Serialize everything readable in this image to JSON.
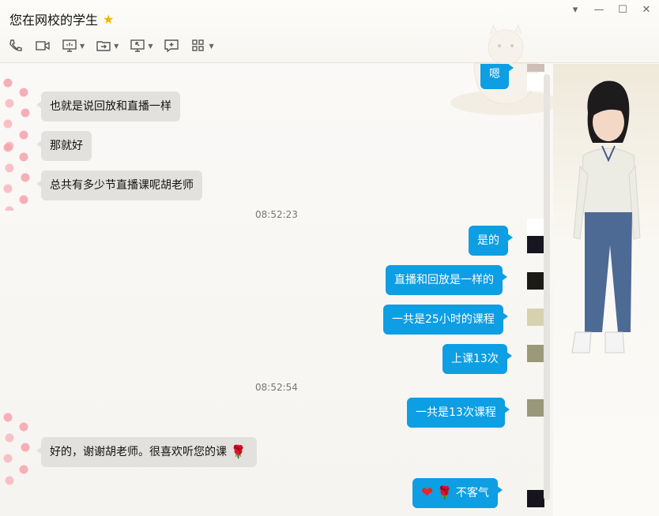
{
  "window": {
    "title": "您在网校的学生",
    "controls": [
      "dropdown-icon",
      "minimize-icon",
      "maximize-icon",
      "close-icon"
    ]
  },
  "toolbar": {
    "items": [
      "phone-icon",
      "video-icon",
      "screen-share-icon",
      "file-transfer-icon",
      "remote-desktop-icon",
      "message-icon",
      "apps-icon"
    ]
  },
  "chat": {
    "messages": [
      {
        "side": "out",
        "text": "嗯"
      },
      {
        "side": "in",
        "text": "也就是说回放和直播一样"
      },
      {
        "side": "in",
        "text": "那就好"
      },
      {
        "side": "in",
        "text": "总共有多少节直播课呢胡老师"
      },
      {
        "side": "time",
        "text": "08:52:23"
      },
      {
        "side": "out",
        "text": "是的"
      },
      {
        "side": "out",
        "text": "直播和回放是一样的"
      },
      {
        "side": "out",
        "text": "一共是25小时的课程"
      },
      {
        "side": "out",
        "text": "上课13次"
      },
      {
        "side": "time",
        "text": "08:52:54"
      },
      {
        "side": "out",
        "text": "一共是13次课程"
      },
      {
        "side": "in",
        "text": "好的，谢谢胡老师。很喜欢听您的课"
      },
      {
        "side": "out",
        "text": "不客气"
      }
    ]
  },
  "colors": {
    "outgoing_bubble": "#0d9ee3",
    "incoming_bubble": "#e3e1de"
  }
}
